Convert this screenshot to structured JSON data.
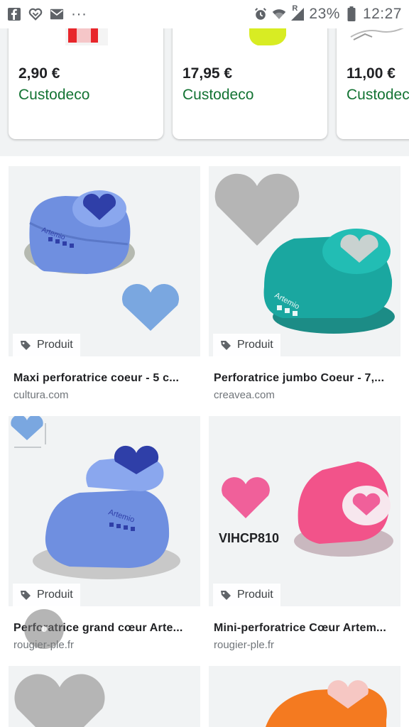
{
  "status_bar": {
    "battery": "23%",
    "time": "12:27",
    "roaming_mark": "R",
    "more": "···"
  },
  "shopping_strip": [
    {
      "price": "2,90 €",
      "seller": "Custodeco"
    },
    {
      "price": "17,95 €",
      "seller": "Custodeco"
    },
    {
      "price": "11,00 €",
      "seller": "Custodeco"
    }
  ],
  "results": [
    {
      "tag": "Produit",
      "title": "Maxi perforatrice coeur - 5 c...",
      "source": "cultura.com",
      "label": ""
    },
    {
      "tag": "Produit",
      "title": "Perforatrice jumbo Coeur - 7,...",
      "source": "creavea.com",
      "label": ""
    },
    {
      "tag": "Produit",
      "title": "Perforatrice grand cœur Arte...",
      "source": "rougier-ple.fr",
      "label": ""
    },
    {
      "tag": "Produit",
      "title": "Mini-perforatrice Cœur Artem...",
      "source": "rougier-ple.fr",
      "label": "VIHCP810"
    }
  ],
  "colors": {
    "seller_green": "#137333",
    "card_bg": "#f1f3f4",
    "heart_blue": "#7aa7e0",
    "heart_grey": "#b5b5b5",
    "heart_pink": "#f0609a",
    "punch_blue": "#6f8fe0",
    "punch_teal": "#1aa7a0",
    "punch_pink": "#f2538a",
    "punch_orange": "#f47a20"
  },
  "icons": [
    "facebook-icon",
    "heart-outline-icon",
    "gmail-icon",
    "alarm-icon",
    "wifi-icon",
    "signal-icon",
    "battery-icon",
    "tag-icon"
  ]
}
